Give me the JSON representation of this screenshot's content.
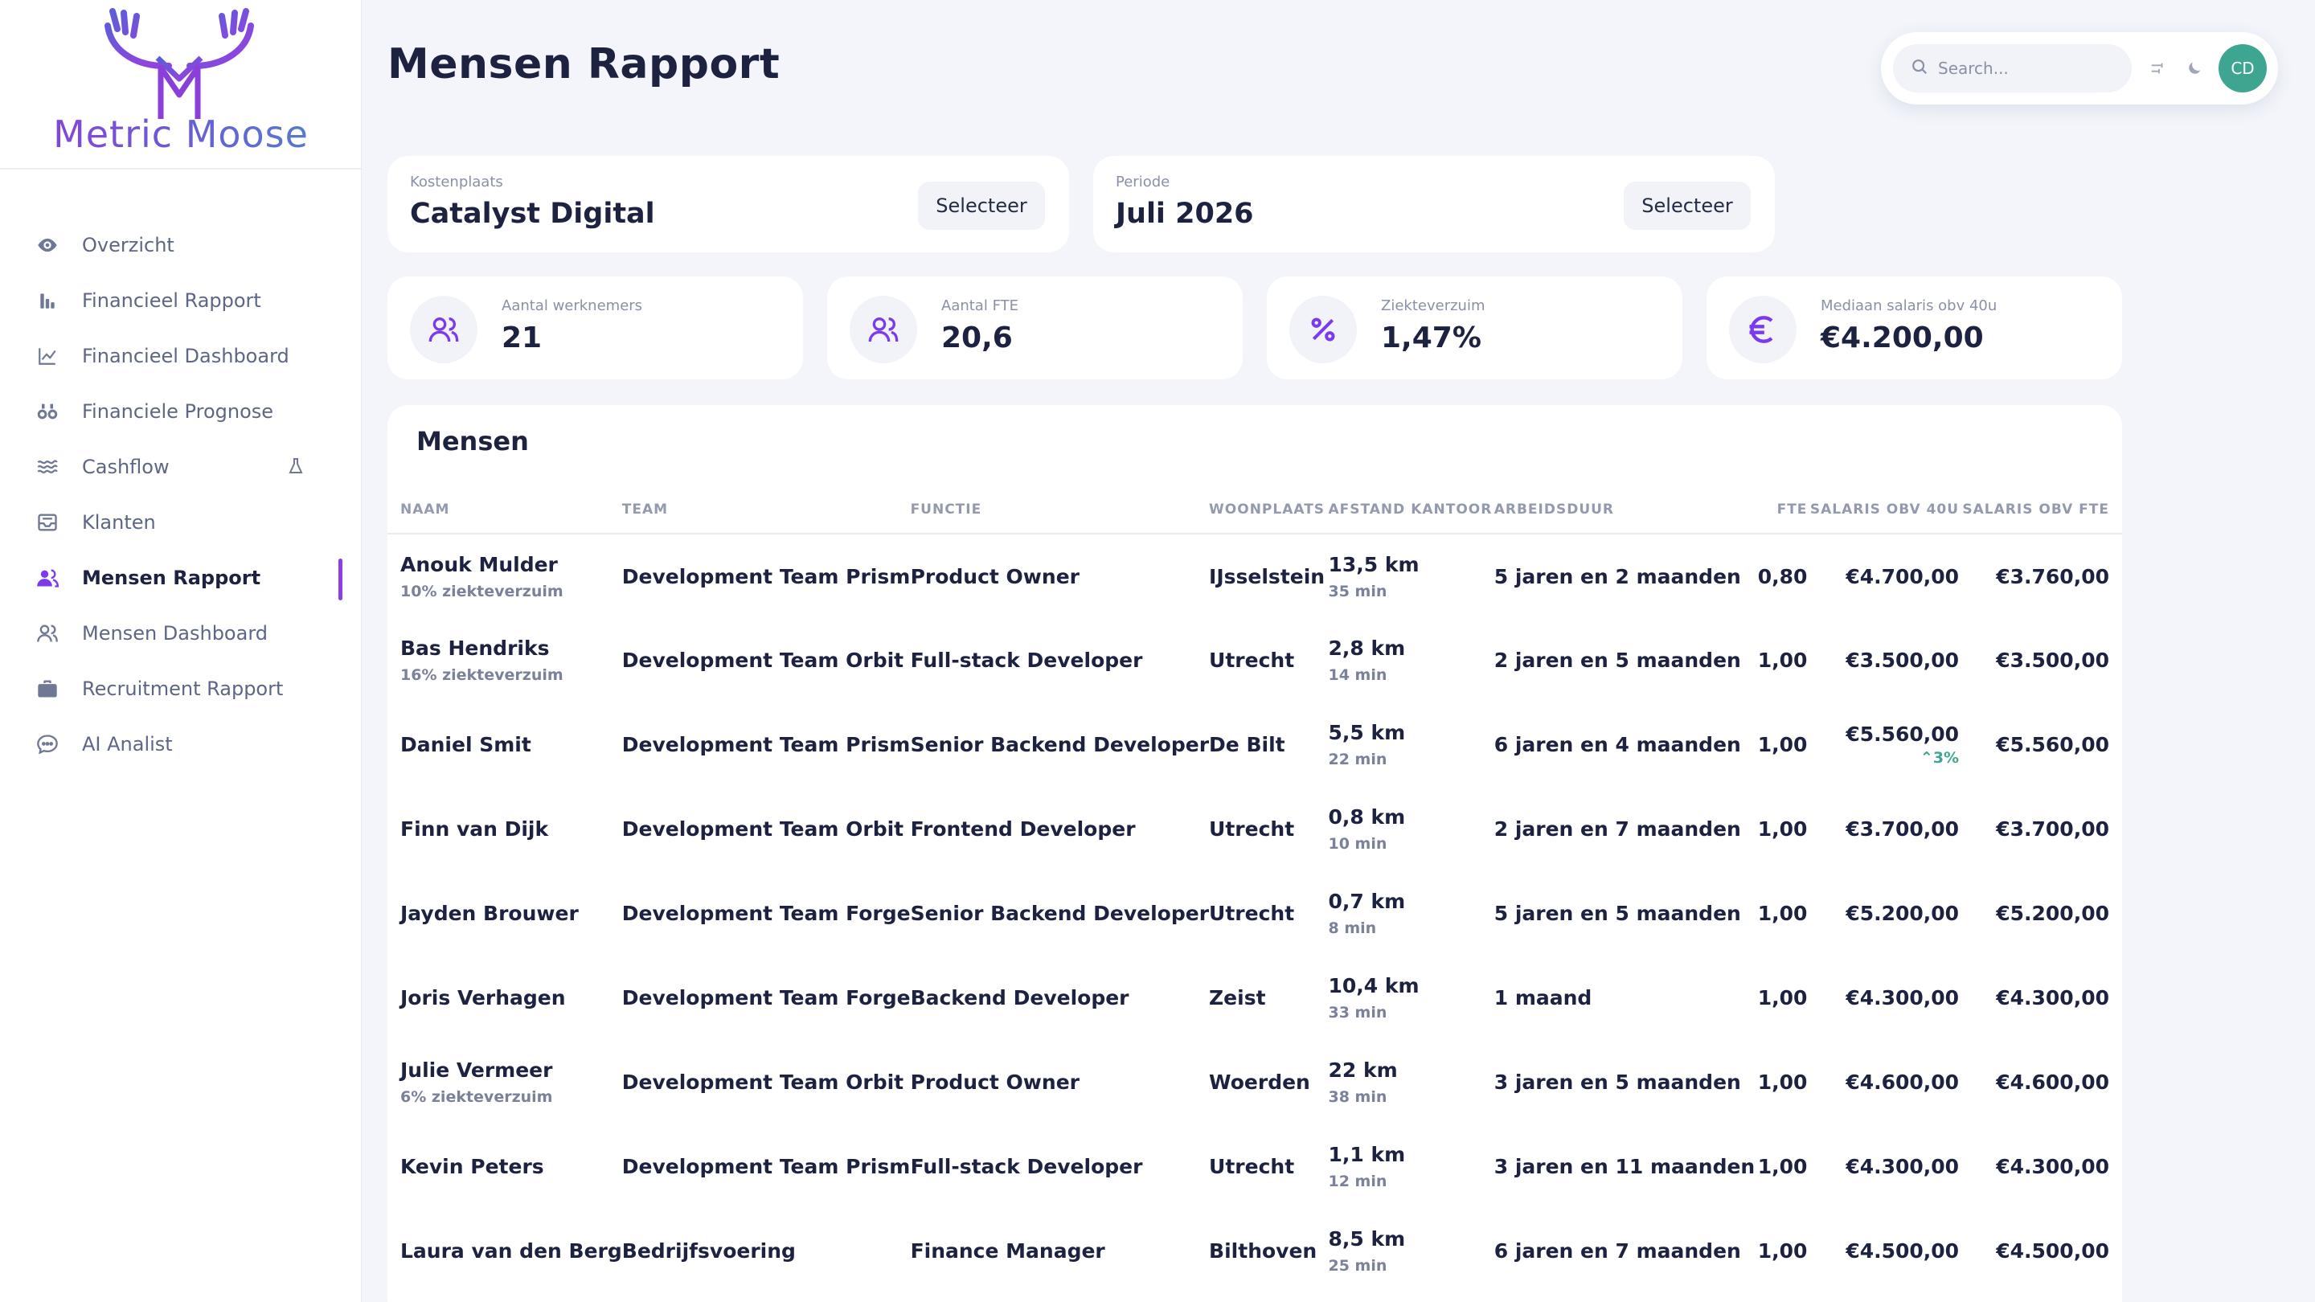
{
  "app": {
    "logo_text": "Metric Moose"
  },
  "sidebar": {
    "items": [
      {
        "label": "Overzicht",
        "icon": "eye-icon"
      },
      {
        "label": "Financieel Rapport",
        "icon": "bar-chart-icon"
      },
      {
        "label": "Financieel Dashboard",
        "icon": "line-chart-icon"
      },
      {
        "label": "Financiele Prognose",
        "icon": "binoculars-icon"
      },
      {
        "label": "Cashflow",
        "icon": "waves-icon",
        "badge_icon": "flask-icon"
      },
      {
        "label": "Klanten",
        "icon": "inbox-icon"
      },
      {
        "label": "Mensen Rapport",
        "icon": "users-icon",
        "active": true
      },
      {
        "label": "Mensen Dashboard",
        "icon": "users-outline-icon"
      },
      {
        "label": "Recruitment Rapport",
        "icon": "briefcase-icon"
      },
      {
        "label": "AI Analist",
        "icon": "chat-icon"
      }
    ]
  },
  "header": {
    "title": "Mensen Rapport",
    "search_placeholder": "Search...",
    "avatar_initials": "CD"
  },
  "filters": {
    "kostenplaats": {
      "label": "Kostenplaats",
      "value": "Catalyst Digital",
      "button": "Selecteer"
    },
    "periode": {
      "label": "Periode",
      "value": "Juli 2026",
      "button": "Selecteer"
    }
  },
  "stats": [
    {
      "label": "Aantal werknemers",
      "value": "21",
      "icon": "users-icon"
    },
    {
      "label": "Aantal FTE",
      "value": "20,6",
      "icon": "users-icon"
    },
    {
      "label": "Ziekteverzuim",
      "value": "1,47%",
      "icon": "percent-icon"
    },
    {
      "label": "Mediaan salaris obv 40u",
      "value": "€4.200,00",
      "icon": "euro-icon"
    }
  ],
  "table": {
    "title": "Mensen",
    "columns": [
      "NAAM",
      "TEAM",
      "FUNCTIE",
      "WOONPLAATS",
      "AFSTAND KANTOOR",
      "ARBEIDSDUUR",
      "FTE",
      "SALARIS OBV 40U",
      "SALARIS OBV FTE"
    ],
    "rows": [
      {
        "naam": "Anouk Mulder",
        "sub": "10% ziekteverzuim",
        "team": "Development Team Prism",
        "functie": "Product Owner",
        "woonplaats": "IJsselstein",
        "afstand": "13,5 km",
        "tijd": "35 min",
        "duur": "5 jaren en 2 maanden",
        "fte": "0,80",
        "sal40": "€4.700,00",
        "change": "",
        "salfte": "€3.760,00"
      },
      {
        "naam": "Bas Hendriks",
        "sub": "16% ziekteverzuim",
        "team": "Development Team Orbit",
        "functie": "Full-stack Developer",
        "woonplaats": "Utrecht",
        "afstand": "2,8 km",
        "tijd": "14 min",
        "duur": "2 jaren en 5 maanden",
        "fte": "1,00",
        "sal40": "€3.500,00",
        "change": "",
        "salfte": "€3.500,00"
      },
      {
        "naam": "Daniel Smit",
        "sub": "",
        "team": "Development Team Prism",
        "functie": "Senior Backend Developer",
        "woonplaats": "De Bilt",
        "afstand": "5,5 km",
        "tijd": "22 min",
        "duur": "6 jaren en 4 maanden",
        "fte": "1,00",
        "sal40": "€5.560,00",
        "change": "3%",
        "salfte": "€5.560,00"
      },
      {
        "naam": "Finn van Dijk",
        "sub": "",
        "team": "Development Team Orbit",
        "functie": "Frontend Developer",
        "woonplaats": "Utrecht",
        "afstand": "0,8 km",
        "tijd": "10 min",
        "duur": "2 jaren en 7 maanden",
        "fte": "1,00",
        "sal40": "€3.700,00",
        "change": "",
        "salfte": "€3.700,00"
      },
      {
        "naam": "Jayden Brouwer",
        "sub": "",
        "team": "Development Team Forge",
        "functie": "Senior Backend Developer",
        "woonplaats": "Utrecht",
        "afstand": "0,7 km",
        "tijd": "8 min",
        "duur": "5 jaren en 5 maanden",
        "fte": "1,00",
        "sal40": "€5.200,00",
        "change": "",
        "salfte": "€5.200,00"
      },
      {
        "naam": "Joris Verhagen",
        "sub": "",
        "team": "Development Team Forge",
        "functie": "Backend Developer",
        "woonplaats": "Zeist",
        "afstand": "10,4 km",
        "tijd": "33 min",
        "duur": "1 maand",
        "fte": "1,00",
        "sal40": "€4.300,00",
        "change": "",
        "salfte": "€4.300,00"
      },
      {
        "naam": "Julie Vermeer",
        "sub": "6% ziekteverzuim",
        "team": "Development Team Orbit",
        "functie": "Product Owner",
        "woonplaats": "Woerden",
        "afstand": "22 km",
        "tijd": "38 min",
        "duur": "3 jaren en 5 maanden",
        "fte": "1,00",
        "sal40": "€4.600,00",
        "change": "",
        "salfte": "€4.600,00"
      },
      {
        "naam": "Kevin Peters",
        "sub": "",
        "team": "Development Team Prism",
        "functie": "Full-stack Developer",
        "woonplaats": "Utrecht",
        "afstand": "1,1 km",
        "tijd": "12 min",
        "duur": "3 jaren en 11 maanden",
        "fte": "1,00",
        "sal40": "€4.300,00",
        "change": "",
        "salfte": "€4.300,00"
      },
      {
        "naam": "Laura van den Berg",
        "sub": "",
        "team": "Bedrijfsvoering",
        "functie": "Finance Manager",
        "woonplaats": "Bilthoven",
        "afstand": "8,5 km",
        "tijd": "25 min",
        "duur": "6 jaren en 7 maanden",
        "fte": "1,00",
        "sal40": "€4.500,00",
        "change": "",
        "salfte": "€4.500,00"
      }
    ]
  },
  "colors": {
    "accent": "#7c3aed",
    "avatar": "#3ea690",
    "positive": "#3ea690",
    "background": "#f3f5fb"
  }
}
